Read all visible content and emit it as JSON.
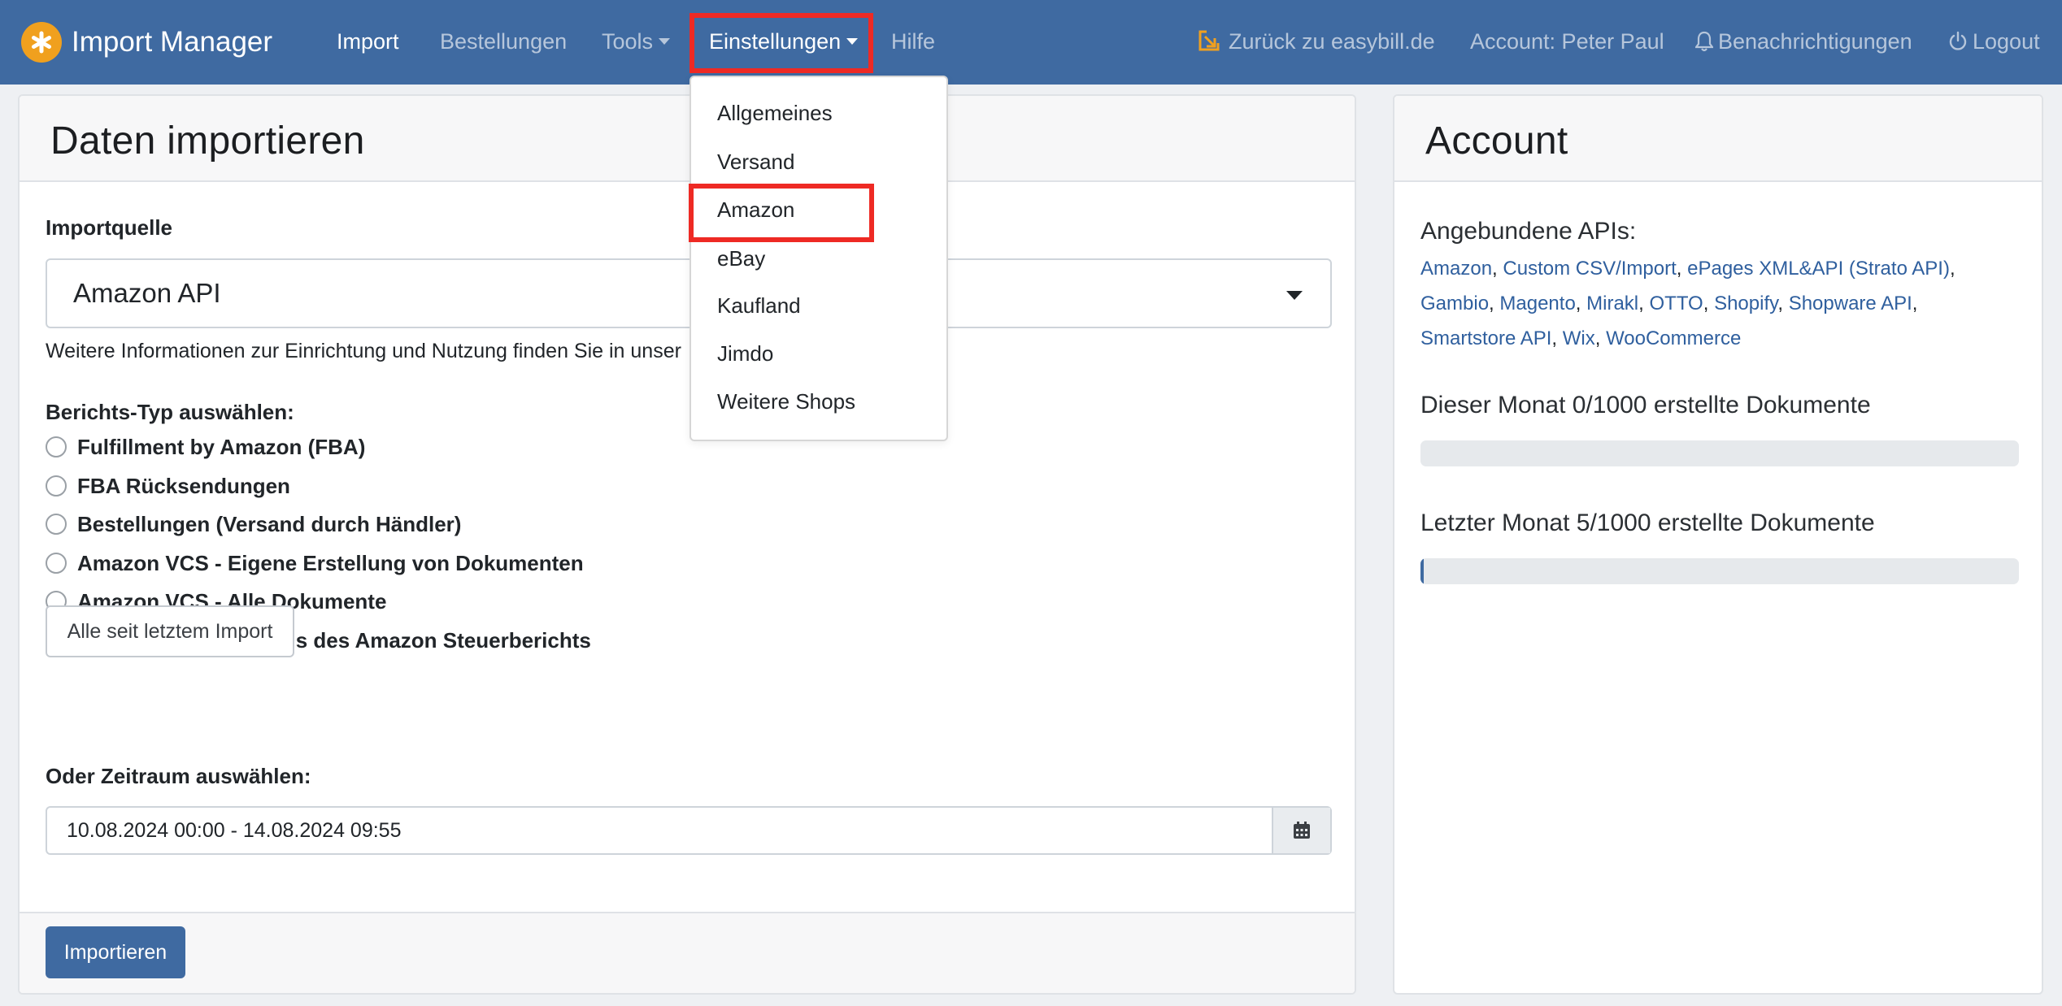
{
  "navbar": {
    "brand": "Import Manager",
    "items": [
      {
        "label": "Import",
        "active": true
      },
      {
        "label": "Bestellungen"
      },
      {
        "label": "Tools"
      },
      {
        "label": "Einstellungen",
        "active": true
      },
      {
        "label": "Hilfe"
      }
    ],
    "right": {
      "back": "Zurück zu easybill.de",
      "account": "Account: Peter Paul",
      "notifications": "Benachrichtigungen",
      "logout": "Logout"
    }
  },
  "settings_menu": {
    "items": [
      "Allgemeines",
      "Versand",
      "Amazon",
      "eBay",
      "Kaufland",
      "Jimdo",
      "Weitere Shops"
    ],
    "highlighted": "Amazon"
  },
  "import_card": {
    "title": "Daten importieren",
    "source_label": "Importquelle",
    "source_value": "Amazon API",
    "info_text": "Weitere Informationen zur Einrichtung und Nutzung finden Sie in unser",
    "report_type_label": "Berichts-Typ auswählen:",
    "report_types": [
      "Fulfillment by Amazon (FBA)",
      "FBA Rücksendungen",
      "Bestellungen (Versand durch Händler)",
      "Amazon VCS - Eigene Erstellung von Dokumenten",
      "Amazon VCS - Alle Dokumente",
      "Prüfungslauf auf Basis des Amazon Steuerberichts"
    ],
    "since_last_button": "Alle seit letztem Import",
    "period_label": "Oder Zeitraum auswählen:",
    "period_value": "10.08.2024 00:00 - 14.08.2024 09:55",
    "import_button": "Importieren"
  },
  "account_card": {
    "title": "Account",
    "apis_label": "Angebundene APIs:",
    "apis": [
      "Amazon",
      "Custom CSV/Import",
      "ePages XML&API (Strato API)",
      "Gambio",
      "Magento",
      "Mirakl",
      "OTTO",
      "Shopify",
      "Shopware API",
      "Smartstore API",
      "Wix",
      "WooCommerce"
    ],
    "this_month_label": "Dieser Monat 0/1000 erstellte Dokumente",
    "this_month_fraction": 0,
    "last_month_label": "Letzter Monat 5/1000 erstellte Dokumente",
    "last_month_fraction": 0.005
  },
  "colors": {
    "navbar": "#3f6aa1",
    "link": "#2f5f9e",
    "logo": "#f0a01e",
    "highlight": "#ee2a24"
  }
}
